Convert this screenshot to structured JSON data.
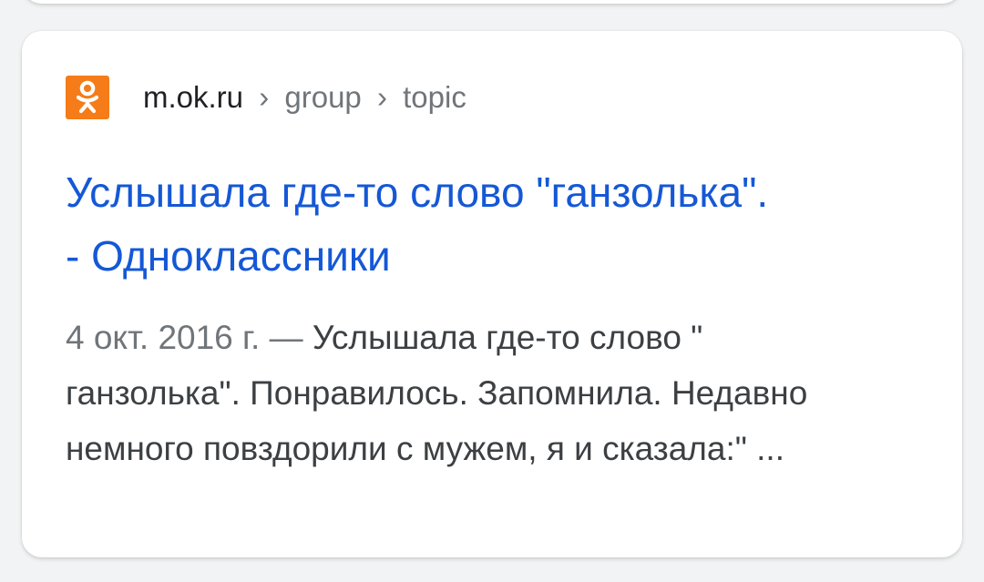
{
  "result": {
    "domain": "m.ok.ru",
    "separator": "›",
    "path": [
      "group",
      "topic"
    ],
    "favicon_icon": "odnoklassniki-logo-icon",
    "favicon_color": "#f57c18",
    "title_line1": "Услышала где-то слово \"ганзолька\".",
    "title_line2": "- Одноклассники",
    "title_color": "#1558d6",
    "snippet_date": "4 окт. 2016 г. —",
    "snippet_text": "Услышала где-то слово \" ганзолька\". Понравилось. Запомнила. Недавно немного повздорили с мужем, я и сказала:\" ..."
  }
}
